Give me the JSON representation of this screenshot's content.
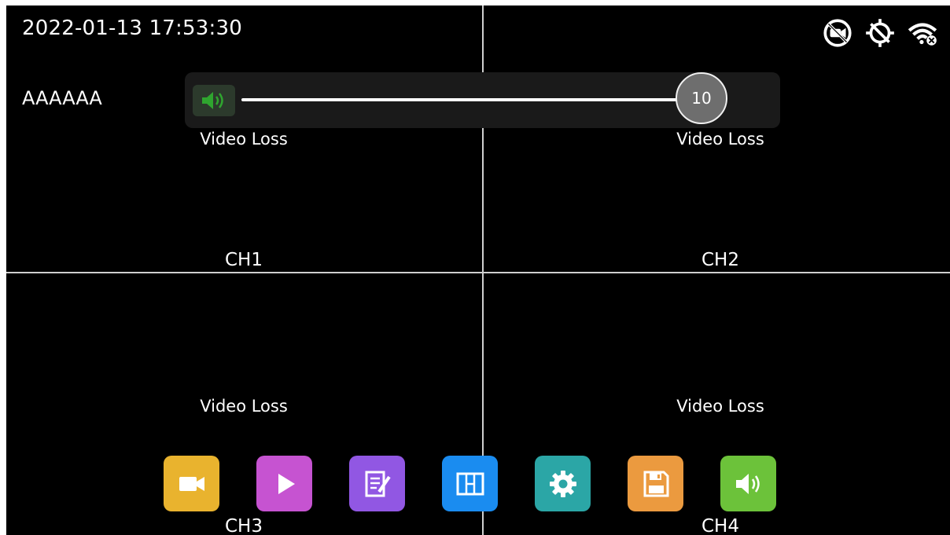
{
  "status_bar": {
    "datetime": "2022-01-13 17:53:30",
    "icons": [
      "no-camera-icon",
      "no-gps-icon",
      "wifi-disconnected-icon"
    ]
  },
  "overlay": {
    "camera_name": "AAAAAA"
  },
  "volume": {
    "value": "10",
    "max": 10,
    "icon": "speaker-icon"
  },
  "channels": [
    {
      "label": "CH1",
      "status": "Video Loss"
    },
    {
      "label": "CH2",
      "status": "Video Loss"
    },
    {
      "label": "CH3",
      "status": "Video Loss"
    },
    {
      "label": "CH4",
      "status": "Video Loss"
    }
  ],
  "toolbar": [
    {
      "icon": "record-icon",
      "color": "#e9b32e"
    },
    {
      "icon": "playback-icon",
      "color": "#c653d1"
    },
    {
      "icon": "edit-icon",
      "color": "#9157e3"
    },
    {
      "icon": "split-view-icon",
      "color": "#1a8cf0"
    },
    {
      "icon": "settings-icon",
      "color": "#2ba6a6"
    },
    {
      "icon": "save-icon",
      "color": "#eb9a3f"
    },
    {
      "icon": "volume-icon",
      "color": "#6cc23a"
    }
  ],
  "colors": {
    "background": "#000000",
    "grid": "#cfcfcf",
    "volume_icon": "#2fa52f"
  }
}
